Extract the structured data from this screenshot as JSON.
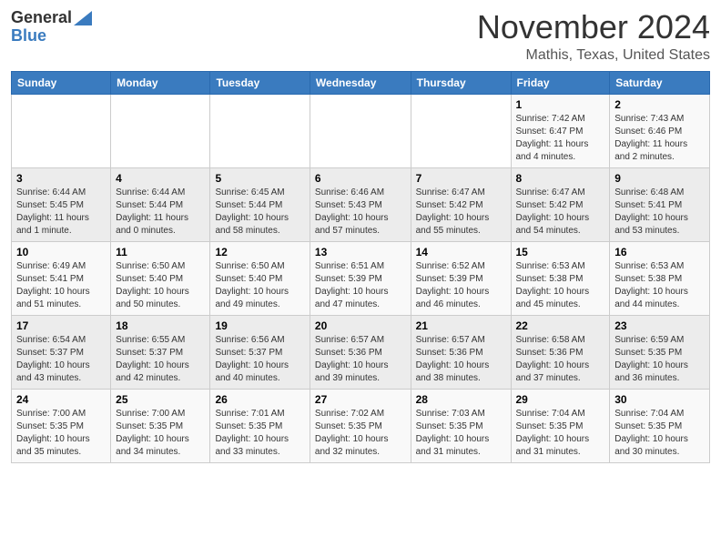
{
  "logo": {
    "general": "General",
    "blue": "Blue"
  },
  "title": "November 2024",
  "location": "Mathis, Texas, United States",
  "days_of_week": [
    "Sunday",
    "Monday",
    "Tuesday",
    "Wednesday",
    "Thursday",
    "Friday",
    "Saturday"
  ],
  "weeks": [
    [
      {
        "day": "",
        "sunrise": "",
        "sunset": "",
        "daylight": ""
      },
      {
        "day": "",
        "sunrise": "",
        "sunset": "",
        "daylight": ""
      },
      {
        "day": "",
        "sunrise": "",
        "sunset": "",
        "daylight": ""
      },
      {
        "day": "",
        "sunrise": "",
        "sunset": "",
        "daylight": ""
      },
      {
        "day": "",
        "sunrise": "",
        "sunset": "",
        "daylight": ""
      },
      {
        "day": "1",
        "sunrise": "Sunrise: 7:42 AM",
        "sunset": "Sunset: 6:47 PM",
        "daylight": "Daylight: 11 hours and 4 minutes."
      },
      {
        "day": "2",
        "sunrise": "Sunrise: 7:43 AM",
        "sunset": "Sunset: 6:46 PM",
        "daylight": "Daylight: 11 hours and 2 minutes."
      }
    ],
    [
      {
        "day": "3",
        "sunrise": "Sunrise: 6:44 AM",
        "sunset": "Sunset: 5:45 PM",
        "daylight": "Daylight: 11 hours and 1 minute."
      },
      {
        "day": "4",
        "sunrise": "Sunrise: 6:44 AM",
        "sunset": "Sunset: 5:44 PM",
        "daylight": "Daylight: 11 hours and 0 minutes."
      },
      {
        "day": "5",
        "sunrise": "Sunrise: 6:45 AM",
        "sunset": "Sunset: 5:44 PM",
        "daylight": "Daylight: 10 hours and 58 minutes."
      },
      {
        "day": "6",
        "sunrise": "Sunrise: 6:46 AM",
        "sunset": "Sunset: 5:43 PM",
        "daylight": "Daylight: 10 hours and 57 minutes."
      },
      {
        "day": "7",
        "sunrise": "Sunrise: 6:47 AM",
        "sunset": "Sunset: 5:42 PM",
        "daylight": "Daylight: 10 hours and 55 minutes."
      },
      {
        "day": "8",
        "sunrise": "Sunrise: 6:47 AM",
        "sunset": "Sunset: 5:42 PM",
        "daylight": "Daylight: 10 hours and 54 minutes."
      },
      {
        "day": "9",
        "sunrise": "Sunrise: 6:48 AM",
        "sunset": "Sunset: 5:41 PM",
        "daylight": "Daylight: 10 hours and 53 minutes."
      }
    ],
    [
      {
        "day": "10",
        "sunrise": "Sunrise: 6:49 AM",
        "sunset": "Sunset: 5:41 PM",
        "daylight": "Daylight: 10 hours and 51 minutes."
      },
      {
        "day": "11",
        "sunrise": "Sunrise: 6:50 AM",
        "sunset": "Sunset: 5:40 PM",
        "daylight": "Daylight: 10 hours and 50 minutes."
      },
      {
        "day": "12",
        "sunrise": "Sunrise: 6:50 AM",
        "sunset": "Sunset: 5:40 PM",
        "daylight": "Daylight: 10 hours and 49 minutes."
      },
      {
        "day": "13",
        "sunrise": "Sunrise: 6:51 AM",
        "sunset": "Sunset: 5:39 PM",
        "daylight": "Daylight: 10 hours and 47 minutes."
      },
      {
        "day": "14",
        "sunrise": "Sunrise: 6:52 AM",
        "sunset": "Sunset: 5:39 PM",
        "daylight": "Daylight: 10 hours and 46 minutes."
      },
      {
        "day": "15",
        "sunrise": "Sunrise: 6:53 AM",
        "sunset": "Sunset: 5:38 PM",
        "daylight": "Daylight: 10 hours and 45 minutes."
      },
      {
        "day": "16",
        "sunrise": "Sunrise: 6:53 AM",
        "sunset": "Sunset: 5:38 PM",
        "daylight": "Daylight: 10 hours and 44 minutes."
      }
    ],
    [
      {
        "day": "17",
        "sunrise": "Sunrise: 6:54 AM",
        "sunset": "Sunset: 5:37 PM",
        "daylight": "Daylight: 10 hours and 43 minutes."
      },
      {
        "day": "18",
        "sunrise": "Sunrise: 6:55 AM",
        "sunset": "Sunset: 5:37 PM",
        "daylight": "Daylight: 10 hours and 42 minutes."
      },
      {
        "day": "19",
        "sunrise": "Sunrise: 6:56 AM",
        "sunset": "Sunset: 5:37 PM",
        "daylight": "Daylight: 10 hours and 40 minutes."
      },
      {
        "day": "20",
        "sunrise": "Sunrise: 6:57 AM",
        "sunset": "Sunset: 5:36 PM",
        "daylight": "Daylight: 10 hours and 39 minutes."
      },
      {
        "day": "21",
        "sunrise": "Sunrise: 6:57 AM",
        "sunset": "Sunset: 5:36 PM",
        "daylight": "Daylight: 10 hours and 38 minutes."
      },
      {
        "day": "22",
        "sunrise": "Sunrise: 6:58 AM",
        "sunset": "Sunset: 5:36 PM",
        "daylight": "Daylight: 10 hours and 37 minutes."
      },
      {
        "day": "23",
        "sunrise": "Sunrise: 6:59 AM",
        "sunset": "Sunset: 5:35 PM",
        "daylight": "Daylight: 10 hours and 36 minutes."
      }
    ],
    [
      {
        "day": "24",
        "sunrise": "Sunrise: 7:00 AM",
        "sunset": "Sunset: 5:35 PM",
        "daylight": "Daylight: 10 hours and 35 minutes."
      },
      {
        "day": "25",
        "sunrise": "Sunrise: 7:00 AM",
        "sunset": "Sunset: 5:35 PM",
        "daylight": "Daylight: 10 hours and 34 minutes."
      },
      {
        "day": "26",
        "sunrise": "Sunrise: 7:01 AM",
        "sunset": "Sunset: 5:35 PM",
        "daylight": "Daylight: 10 hours and 33 minutes."
      },
      {
        "day": "27",
        "sunrise": "Sunrise: 7:02 AM",
        "sunset": "Sunset: 5:35 PM",
        "daylight": "Daylight: 10 hours and 32 minutes."
      },
      {
        "day": "28",
        "sunrise": "Sunrise: 7:03 AM",
        "sunset": "Sunset: 5:35 PM",
        "daylight": "Daylight: 10 hours and 31 minutes."
      },
      {
        "day": "29",
        "sunrise": "Sunrise: 7:04 AM",
        "sunset": "Sunset: 5:35 PM",
        "daylight": "Daylight: 10 hours and 31 minutes."
      },
      {
        "day": "30",
        "sunrise": "Sunrise: 7:04 AM",
        "sunset": "Sunset: 5:35 PM",
        "daylight": "Daylight: 10 hours and 30 minutes."
      }
    ]
  ]
}
